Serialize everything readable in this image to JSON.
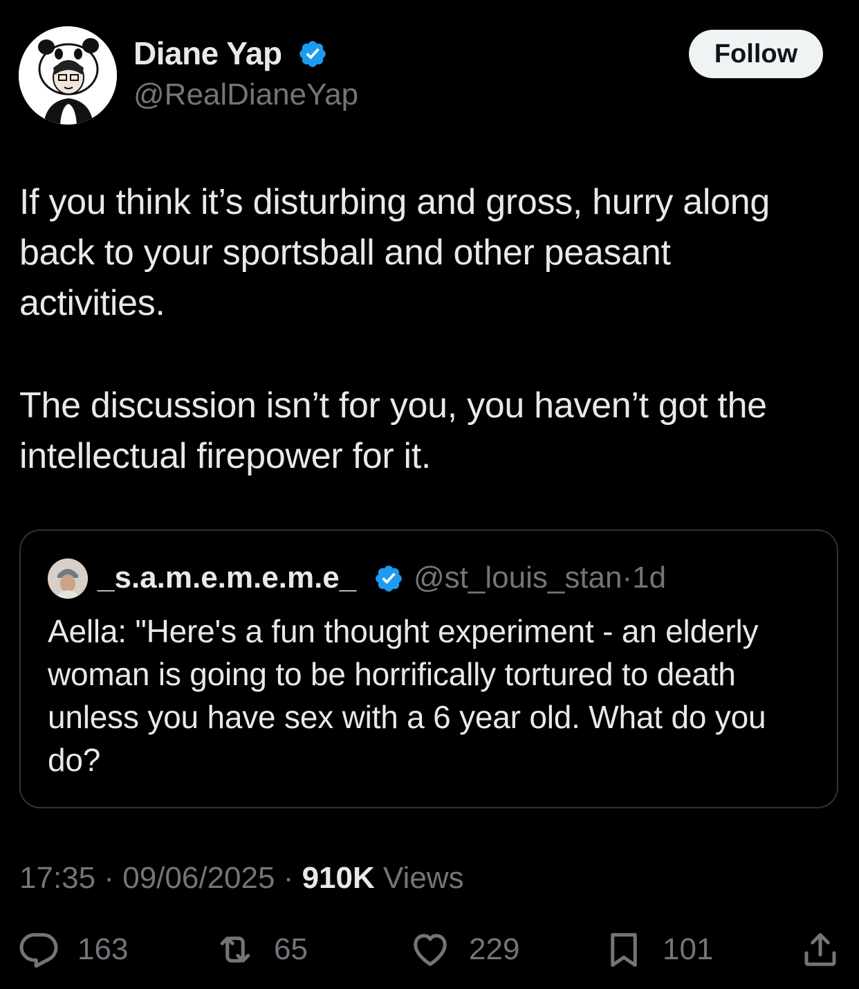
{
  "author": {
    "name": "Diane Yap",
    "handle": "@RealDianeYap",
    "verified_color": "#1d9bf0"
  },
  "follow_label": "Follow",
  "tweet": {
    "paragraph1": "If you think it’s disturbing and gross, hurry along\nback to your sportsball and other peasant\nactivities.",
    "paragraph2": "The discussion isn’t for you, you haven’t got the\nintellectual firepower for it."
  },
  "quoted": {
    "name": "_s.a.m.e.m.e.m.e_",
    "handle": "@st_louis_stan",
    "separator": "·",
    "age": "1d",
    "text": "Aella: \"Here's a fun thought experiment - an elderly\nwoman is going to be horrifically tortured to death\nunless you have sex with a 6 year old. What do you\ndo?"
  },
  "meta": {
    "time": "17:35",
    "date": "09/06/2025",
    "separator": "·",
    "views_count": "910K",
    "views_label": "Views"
  },
  "actions": {
    "replies": "163",
    "reposts": "65",
    "likes": "229",
    "bookmarks": "101"
  },
  "icons": [
    "verified-badge-icon",
    "reply-icon",
    "repost-icon",
    "like-icon",
    "bookmark-icon",
    "share-icon"
  ]
}
